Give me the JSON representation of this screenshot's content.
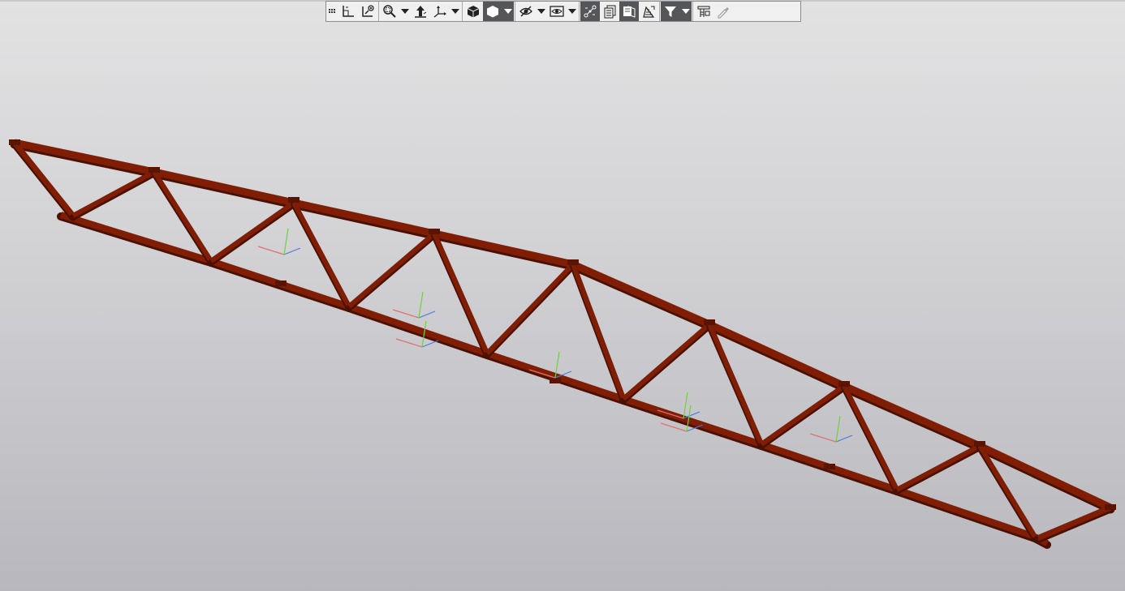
{
  "viewport": {
    "background_top": "#e2e2e3",
    "background_bottom": "#b7b7bd",
    "model_color": "#7f1e05",
    "model_shadow": "#4a1003"
  },
  "toolbar": {
    "buttons": [
      {
        "icon": "toolbar-grip-icon"
      },
      {
        "icon": "local-coordinate-system-icon"
      },
      {
        "icon": "zoom-to-fit-icon"
      },
      {
        "icon": "zoom-window-icon"
      },
      {
        "icon": "dropdown-arrow-icon"
      },
      {
        "icon": "orientation-icon"
      },
      {
        "icon": "coordinate-axes-icon"
      },
      {
        "icon": "dropdown-arrow-icon"
      },
      {
        "icon": "solid-cube-icon"
      },
      {
        "icon": "shaded-display-icon",
        "active": true
      },
      {
        "icon": "dropdown-arrow-icon"
      },
      {
        "icon": "hide-icon"
      },
      {
        "icon": "dropdown-arrow-icon"
      },
      {
        "icon": "show-hidden-icon"
      },
      {
        "icon": "dropdown-arrow-icon"
      },
      {
        "icon": "constraints-icon",
        "active": true
      },
      {
        "icon": "layers-icon"
      },
      {
        "icon": "section-view-icon",
        "active": true
      },
      {
        "icon": "plane-layers-icon"
      },
      {
        "icon": "filter-icon",
        "active": true
      },
      {
        "icon": "dropdown-arrow-icon"
      },
      {
        "icon": "assembly-tree-icon"
      },
      {
        "icon": "eyedropper-icon"
      }
    ]
  }
}
